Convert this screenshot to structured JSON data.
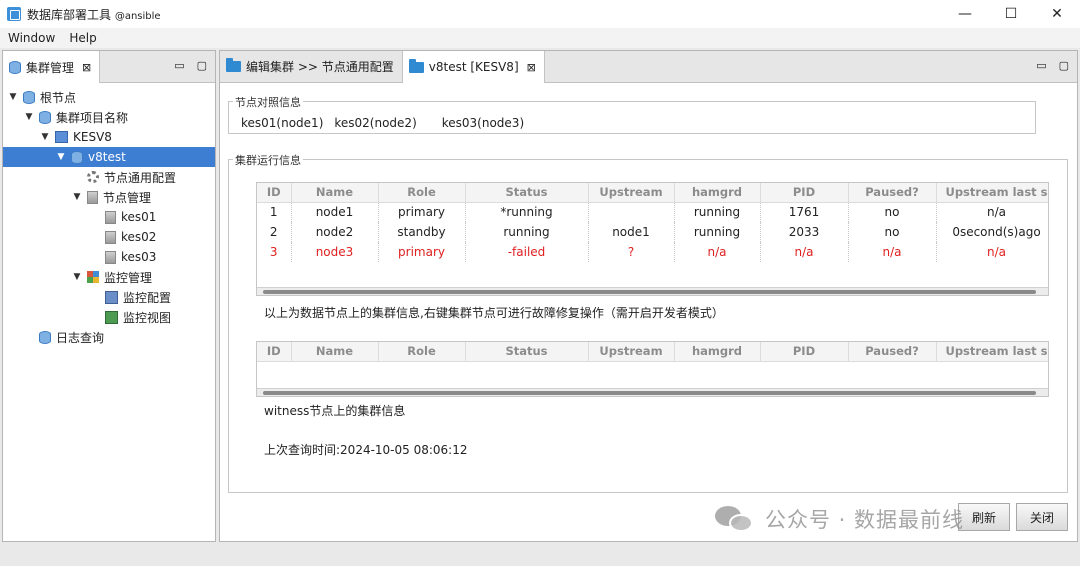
{
  "window": {
    "title": "数据库部署工具",
    "subtitle": "@ansible",
    "minimize": "—",
    "maximize": "☐",
    "close": "✕"
  },
  "menu": [
    "Window",
    "Help"
  ],
  "left_panel": {
    "tab_label": "集群管理",
    "tab_close": "⊠",
    "minimize": "▭",
    "maximize": "▢",
    "tree": [
      {
        "label": "根节点",
        "arrow": "▼",
        "icon": "database-icon"
      },
      {
        "label": "集群项目名称",
        "arrow": "▼",
        "icon": "database-icon"
      },
      {
        "label": "KESV8",
        "arrow": "▼",
        "icon": "kesv-icon"
      },
      {
        "label": "v8test",
        "arrow": "▼",
        "icon": "database-icon",
        "selected": true
      },
      {
        "label": "节点通用配置",
        "arrow": "",
        "icon": "gear-icon"
      },
      {
        "label": "节点管理",
        "arrow": "▼",
        "icon": "server-icon"
      },
      {
        "label": "kes01",
        "arrow": "",
        "icon": "server-icon"
      },
      {
        "label": "kes02",
        "arrow": "",
        "icon": "server-icon"
      },
      {
        "label": "kes03",
        "arrow": "",
        "icon": "server-icon"
      },
      {
        "label": "监控管理",
        "arrow": "▼",
        "icon": "grid-icon"
      },
      {
        "label": "监控配置",
        "arrow": "",
        "icon": "config-icon"
      },
      {
        "label": "监控视图",
        "arrow": "",
        "icon": "view-icon"
      },
      {
        "label": "日志查询",
        "arrow": "",
        "icon": "database-icon"
      }
    ]
  },
  "right_panel": {
    "tabs": [
      {
        "label": "编辑集群 >> 节点通用配置",
        "active": false
      },
      {
        "label": "v8test [KESV8]",
        "active": true,
        "close": "⊠"
      }
    ],
    "minimize": "▭",
    "maximize": "▢",
    "node_map": {
      "label": "节点对照信息",
      "items": [
        "kes01(node1)",
        "kes02(node2)",
        "kes03(node3)"
      ]
    },
    "cluster_info": {
      "label": "集群运行信息",
      "columns": [
        "ID",
        "Name",
        "Role",
        "Status",
        "Upstream",
        "hamgrd",
        "PID",
        "Paused?",
        "Upstream last s"
      ],
      "rows": [
        [
          "1",
          "node1",
          "primary",
          "*running",
          "",
          "running",
          "1761",
          "no",
          "n/a"
        ],
        [
          "2",
          "node2",
          "standby",
          "running",
          "node1",
          "running",
          "2033",
          "no",
          "0second(s)ago"
        ],
        [
          "3",
          "node3",
          "primary",
          "-failed",
          "?",
          "n/a",
          "n/a",
          "n/a",
          "n/a"
        ]
      ],
      "failed_row_color": "#e02020",
      "note": "以上为数据节点上的集群信息,右键集群节点可进行故障修复操作（需开启开发者模式）",
      "witness_columns": [
        "ID",
        "Name",
        "Role",
        "Status",
        "Upstream",
        "hamgrd",
        "PID",
        "Paused?",
        "Upstream last s"
      ],
      "witness_note": "witness节点上的集群信息",
      "last_query": "上次查询时间:2024-10-05 08:06:12"
    },
    "buttons": {
      "refresh": "刷新",
      "close": "关闭"
    }
  },
  "watermark": "公众号 · 数据最前线",
  "colors": {
    "selection": "#3d7ed3",
    "accent": "#2f8ad2",
    "failed": "#e02020"
  }
}
